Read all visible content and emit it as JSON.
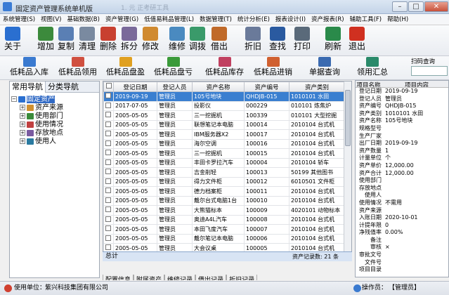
{
  "window": {
    "title": "固定资产管理系统单机版",
    "ghost_title": "1. 元 正考研工具"
  },
  "menu": [
    "系统管理(S)",
    "视图(V)",
    "基础数据(B)",
    "资产管理(G)",
    "低值易耗品管理(L)",
    "数据管理(T)",
    "统计分析(E)",
    "报表设计(I)",
    "资产报表(R)",
    "辅助工具(F)",
    "帮助(H)"
  ],
  "toolbar": [
    {
      "label": "关于",
      "icon": "about-icon",
      "color": "#2a6fd0"
    },
    {
      "label": "增加",
      "icon": "add-icon",
      "color": "#3c8a3c"
    },
    {
      "label": "复制",
      "icon": "copy-icon",
      "color": "#5a7fb4"
    },
    {
      "label": "清理",
      "icon": "clean-icon",
      "color": "#7a8aa0"
    },
    {
      "label": "删除",
      "icon": "delete-icon",
      "color": "#c84030"
    },
    {
      "label": "拆分",
      "icon": "split-icon",
      "color": "#7a6a9a"
    },
    {
      "label": "修改",
      "icon": "edit-icon",
      "color": "#d08a30"
    },
    {
      "label": "维修",
      "icon": "repair-icon",
      "color": "#4a8ac0"
    },
    {
      "label": "调拨",
      "icon": "transfer-icon",
      "color": "#3a9a6a"
    },
    {
      "label": "借出",
      "icon": "lend-icon",
      "color": "#c06a2a"
    },
    {
      "label": "折旧",
      "icon": "depreciation-icon",
      "color": "#6a7a9a"
    },
    {
      "label": "查找",
      "icon": "find-icon",
      "color": "#2a5aa0"
    },
    {
      "label": "打印",
      "icon": "print-icon",
      "color": "#5a6a7a"
    },
    {
      "label": "刷新",
      "icon": "refresh-icon",
      "color": "#2a8a4a"
    },
    {
      "label": "退出",
      "icon": "exit-icon",
      "color": "#d03020"
    }
  ],
  "toolbar2": [
    {
      "label": "低耗品入库",
      "icon": "lv-in-icon",
      "color": "#3a7ad0"
    },
    {
      "label": "低耗品领用",
      "icon": "lv-use-icon",
      "color": "#d05040"
    },
    {
      "label": "低耗品盘盈",
      "icon": "lv-surplus-icon",
      "color": "#e0a020"
    },
    {
      "label": "低耗品盘亏",
      "icon": "lv-loss-icon",
      "color": "#3a9a3a"
    },
    {
      "label": "低耗品库存",
      "icon": "lv-stock-icon",
      "color": "#c04060"
    },
    {
      "label": "低耗品进销",
      "icon": "lv-flow-icon",
      "color": "#d06030"
    },
    {
      "label": "单据查询",
      "icon": "doc-query-icon",
      "color": "#3a6ab0"
    },
    {
      "label": "领用汇总",
      "icon": "summary-icon",
      "color": "#2a8a6a"
    }
  ],
  "scan": {
    "label": "扫码查询",
    "value": ""
  },
  "nav_tabs": [
    "常用导航",
    "分类导航"
  ],
  "tree": [
    {
      "label": "固定资产",
      "level": 0,
      "expander": "−",
      "color": "#2a6fd0",
      "selected": true
    },
    {
      "label": "资产来源",
      "level": 1,
      "expander": "+",
      "color": "#d09030",
      "selected": false
    },
    {
      "label": "使用部门",
      "level": 1,
      "expander": "+",
      "color": "#3a8a3a",
      "selected": false
    },
    {
      "label": "使用情况",
      "level": 1,
      "expander": "+",
      "color": "#c04040",
      "selected": false
    },
    {
      "label": "存放地点",
      "level": 1,
      "expander": "+",
      "color": "#7a5aa0",
      "selected": false
    },
    {
      "label": "使用人",
      "level": 1,
      "expander": "+",
      "color": "#2a7aa0",
      "selected": false
    }
  ],
  "grid": {
    "headers": [
      "",
      "登记日期",
      "登记人员",
      "资产名称",
      "资产编号",
      "资产类别"
    ],
    "rows": [
      [
        "2019-09-19",
        "管理员",
        "105号地块",
        "QHDJB-015",
        "1010101 水田"
      ],
      [
        "2017-07-05",
        "管理员",
        "投影仪",
        "000229",
        "010101 炼焦炉"
      ],
      [
        "2005-05-05",
        "管理员",
        "三一挖掘机",
        "100339",
        "010101 大型挖掘"
      ],
      [
        "2005-05-05",
        "管理员",
        "联想笔记本电脑",
        "100014",
        "2010104 台式机"
      ],
      [
        "2005-05-05",
        "管理员",
        "IBM服务器X2",
        "100017",
        "2010104 台式机"
      ],
      [
        "2005-05-05",
        "管理员",
        "海尔空调",
        "100016",
        "2010104 台式机"
      ],
      [
        "2005-05-05",
        "管理员",
        "三一挖掘机",
        "100015",
        "2010104 台式机"
      ],
      [
        "2005-05-05",
        "管理员",
        "丰田卡罗拉汽车",
        "100004",
        "2010104 轿车"
      ],
      [
        "2005-05-05",
        "管理员",
        "吉金削轻",
        "100013",
        "50199 其他图书"
      ],
      [
        "2005-05-05",
        "管理员",
        "得力文件柜",
        "100012",
        "6010501 文件柜"
      ],
      [
        "2005-05-05",
        "管理员",
        "德力档案柜",
        "100011",
        "2010104 台式机"
      ],
      [
        "2005-05-05",
        "管理员",
        "戴尔台式电脑1台",
        "100010",
        "2010104 台式机"
      ],
      [
        "2005-05-05",
        "管理员",
        "大熊猫标本",
        "100009",
        "4020101 动物标本"
      ],
      [
        "2005-05-05",
        "管理员",
        "奥迪A4L汽车",
        "100008",
        "2010104 台式机"
      ],
      [
        "2005-05-05",
        "管理员",
        "本田飞度汽车",
        "100007",
        "2010104 台式机"
      ],
      [
        "2005-05-05",
        "管理员",
        "戴尔笔记本电脑",
        "100006",
        "2010104 台式机"
      ],
      [
        "2005-05-05",
        "管理员",
        "大会议桌",
        "100005",
        "2010104 台式机"
      ]
    ]
  },
  "totals": {
    "label": "总计",
    "count_text": "资产记录数: 21 条"
  },
  "grid_tabs": [
    "配置信息",
    "附属资产",
    "维修记录",
    "借出记录",
    "折旧记录"
  ],
  "detail": {
    "headers": [
      "项目名称",
      "项目内容"
    ],
    "rows": [
      [
        "登记日期",
        "2019-09-19"
      ],
      [
        "登记人员",
        "管理员"
      ],
      [
        "资产编号",
        "QHDJB-015"
      ],
      [
        "资产类别",
        "1010101 水田"
      ],
      [
        "资产名称",
        "105号地块"
      ],
      [
        "规格型号",
        ""
      ],
      [
        "生产厂家",
        ""
      ],
      [
        "出厂日期",
        "2019-09-19"
      ],
      [
        "资产数量",
        "1"
      ],
      [
        "计量单位",
        "个"
      ],
      [
        "资产单价",
        "12,000.00"
      ],
      [
        "资产合计",
        "12,000.00"
      ],
      [
        "使用部门",
        ""
      ],
      [
        "存放地点",
        ""
      ],
      [
        "使用人",
        ""
      ],
      [
        "使用情况",
        "不需用"
      ],
      [
        "资产来源",
        ""
      ],
      [
        "入账日期",
        "2020-10-01"
      ],
      [
        "计提年限",
        "0"
      ],
      [
        "净残值率",
        "0.00%"
      ],
      [
        "备注",
        ""
      ],
      [
        "审核",
        "×"
      ],
      [
        "审批文号",
        ""
      ],
      [
        "文件号",
        ""
      ],
      [
        "项目目录",
        ""
      ]
    ]
  },
  "status": {
    "unit_label": "使用单位：",
    "unit_value": "紫兴科技集团有限公司",
    "operator_label": "操作员：",
    "operator_value": "【管理员】"
  }
}
